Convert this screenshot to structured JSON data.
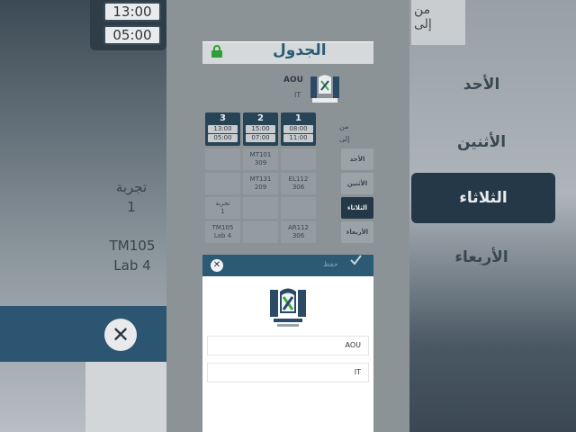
{
  "app": {
    "logo_text_main": "الجدول",
    "org_name": "AOU",
    "department": "IT"
  },
  "range": {
    "from_label": "من",
    "to_label": "إلى"
  },
  "slots": [
    {
      "number": "3",
      "start": "13:00",
      "end": "05:00"
    },
    {
      "number": "2",
      "start": "15:00",
      "end": "07:00"
    },
    {
      "number": "1",
      "start": "08:00",
      "end": "11:00"
    }
  ],
  "days": [
    {
      "label": "الأحد",
      "active": false
    },
    {
      "label": "الأثنين",
      "active": false
    },
    {
      "label": "الثلاثاء",
      "active": true
    },
    {
      "label": "الأربعاء",
      "active": false
    }
  ],
  "grid": {
    "r1": {
      "c2": {
        "code": "MT101",
        "room": "309"
      }
    },
    "r2": {
      "c2": {
        "code": "MT131",
        "room": "209"
      },
      "c1": {
        "code": "EL112",
        "room": "306"
      }
    },
    "r3": {
      "c3": {
        "code": "تجربة",
        "room": "1"
      }
    },
    "r4": {
      "c3": {
        "code": "TM105",
        "room": "Lab 4"
      },
      "c1": {
        "code": "AR112",
        "room": "306"
      }
    }
  },
  "sheet": {
    "save_label": "حفظ",
    "field1_value": "AOU",
    "field2_value": "IT"
  },
  "background": {
    "left_times": [
      "13:00",
      "05:00"
    ],
    "left_text1": [
      "تجربة",
      "1"
    ],
    "left_text2": [
      "TM105",
      "Lab 4"
    ],
    "right_top": [
      "من",
      "إلى"
    ],
    "right_days": [
      "الأحد",
      "الأثنين",
      "الثلاثاء",
      "الأربعاء"
    ]
  },
  "colors": {
    "primary": "#274457",
    "accent_green": "#3cab3c",
    "sheet_header": "#2c5a75"
  }
}
